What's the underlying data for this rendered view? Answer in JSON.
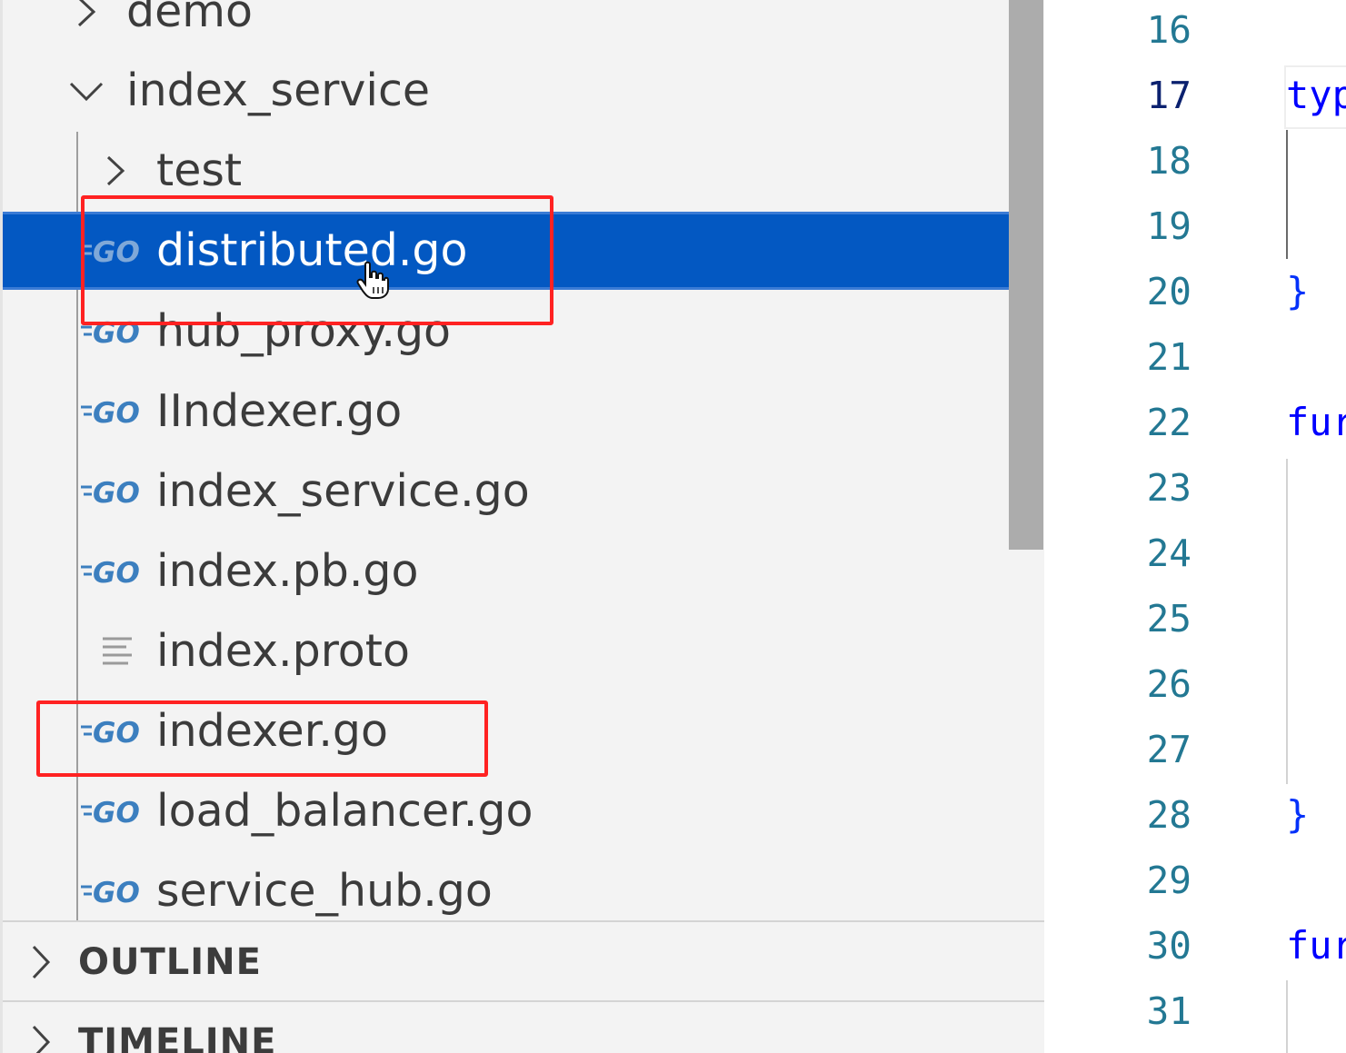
{
  "explorer": {
    "folders": {
      "demo": "demo",
      "index_service": "index_service",
      "test": "test"
    },
    "files": [
      {
        "name": "distributed.go",
        "type": "go"
      },
      {
        "name": "hub_proxy.go",
        "type": "go"
      },
      {
        "name": "IIndexer.go",
        "type": "go"
      },
      {
        "name": "index_service.go",
        "type": "go"
      },
      {
        "name": "index.pb.go",
        "type": "go"
      },
      {
        "name": "index.proto",
        "type": "text"
      },
      {
        "name": "indexer.go",
        "type": "go"
      },
      {
        "name": "load_balancer.go",
        "type": "go"
      },
      {
        "name": "service_hub.go",
        "type": "go"
      }
    ],
    "selected_file": "distributed.go",
    "go_icon_text": "GO"
  },
  "panels": {
    "outline": "OUTLINE",
    "timeline": "TIMELINE"
  },
  "editor": {
    "line_numbers": [
      "16",
      "17",
      "18",
      "19",
      "20",
      "21",
      "22",
      "23",
      "24",
      "25",
      "26",
      "27",
      "28",
      "29",
      "30",
      "31"
    ],
    "active_line": "17",
    "code": {
      "l17": "typ",
      "l20": "}",
      "l22": "fur",
      "l28": "}",
      "l30": "fur"
    }
  },
  "colors": {
    "selection": "#0358c2",
    "annotation": "#ff2222",
    "go_icon": "#3c7fbf",
    "line_number": "#237893",
    "keyword": "#0000ff"
  }
}
